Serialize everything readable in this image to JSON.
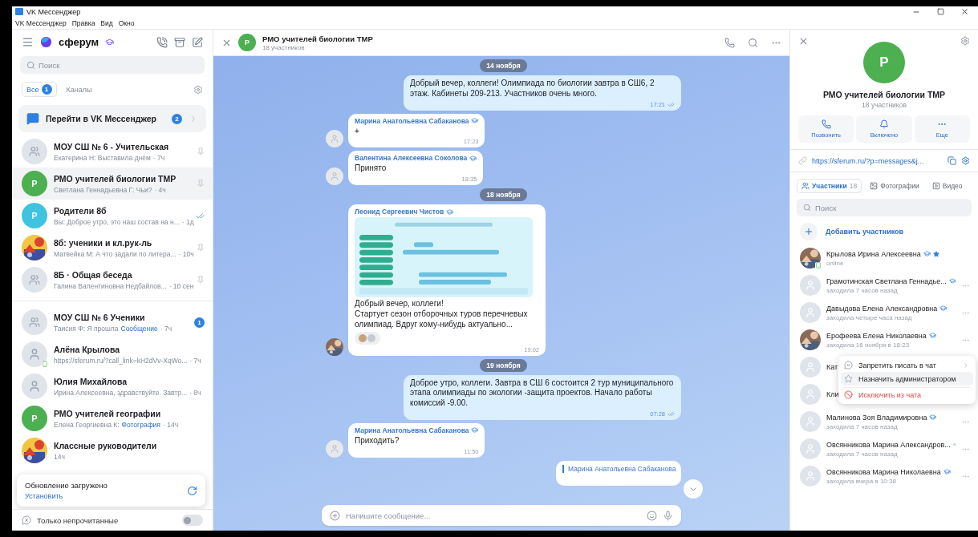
{
  "window": {
    "title": "VK Мессенджер"
  },
  "menu_bar": [
    "VK Мессенджер",
    "Правка",
    "Вид",
    "Окно"
  ],
  "sidebar": {
    "logo": "сферум",
    "search": {
      "placeholder": "Поиск"
    },
    "filters": [
      {
        "label": "Все",
        "badge": "1",
        "selected": true
      },
      {
        "label": "Каналы",
        "selected": false
      }
    ],
    "promo": {
      "label": "Перейти в VK Мессенджер",
      "badge": "2"
    },
    "pinned_chats": [
      {
        "name": "МОУ СШ № 6 - Учительская",
        "preview": "Екатерина Н: Выставила днём",
        "time": "· 7ч",
        "avatar": {
          "kind": "group"
        },
        "pinned": true,
        "selected": false
      },
      {
        "name": "РМО учителей биологии ТМР",
        "preview": "Светлана Геннадьевна Г: Чьи?",
        "time": "· 4ч",
        "avatar": {
          "kind": "letter",
          "letter": "Р",
          "color": "#4caf50"
        },
        "pinned": true,
        "selected": true
      },
      {
        "name": "Родители 8б",
        "preview": "Вы: Доброе утро, это наш состав на н...",
        "time": "· 1д",
        "avatar": {
          "kind": "letter",
          "letter": "Р",
          "color": "#3ec3e0"
        },
        "pinned": false,
        "read": true,
        "selected": false
      },
      {
        "name": "8б: ученики и кл.рук-ль",
        "preview": "Матвейка М: А что задали по литера...",
        "time": "· 10ч",
        "pinned": true,
        "selected": false
      },
      {
        "name": "8Б · Общая беседа",
        "preview": "Галина Валентиновна Недбайлов...",
        "time": "· 10 сен",
        "avatar": {
          "kind": "group"
        },
        "pinned": true,
        "selected": false
      }
    ],
    "chats": [
      {
        "name": "МОУ СШ № 6 Ученики",
        "preview": "Таисия Ф: Я прошла",
        "attachment": "Сообщение",
        "time": "· 7ч",
        "avatar": {
          "kind": "group"
        },
        "unread": "1",
        "selected": false
      },
      {
        "name": "Алёна Крылова",
        "preview": "https://sferum.ru/?call_link=kH2dVv-XqWo...",
        "time": "· 7ч",
        "avatar": {
          "kind": "person"
        },
        "online": true,
        "selected": false
      },
      {
        "name": "Юлия Михайлова",
        "preview": "Ирина Алексеевна, здравствуйте. Завтр...",
        "time": "· 8ч",
        "avatar": {
          "kind": "person"
        },
        "selected": false
      },
      {
        "name": "РМО учителей географии",
        "preview": "Елена Георгиевна К:",
        "attachment": "Фотография",
        "time": "· 14ч",
        "avatar": {
          "kind": "letter",
          "letter": "Р",
          "color": "#4caf50"
        },
        "selected": false
      },
      {
        "name": "Классные руководители",
        "time": "14ч",
        "selected": false
      }
    ],
    "toast": {
      "title": "Обновление загружено",
      "action": "Установить"
    },
    "unread_only": {
      "label": "Только непрочитанные",
      "on": false
    }
  },
  "chat": {
    "avatar_letter": "Р",
    "title": "РМО учителей биологии ТМР",
    "subtitle": "18 участников",
    "messages": [
      {
        "kind": "date",
        "text": "14 ноября"
      },
      {
        "kind": "outgoing",
        "text": "Добрый вечер, коллеги! Олимпиада по биологии завтра в СШ6, 2 этаж. Кабинеты 209-213. Участников очень много.",
        "time": "17:21",
        "read": true
      },
      {
        "kind": "incoming",
        "author": "Марина Анатольевна Сабаканова",
        "text": "+",
        "time": "17:23"
      },
      {
        "kind": "incoming",
        "author": "Валентина Алексеевна Соколова",
        "text": "Принято",
        "time": "18:35"
      },
      {
        "kind": "date",
        "text": "18 ноября"
      },
      {
        "kind": "incoming",
        "author": "Леонид Сергеевич Чистов",
        "picture": true,
        "text": "Добрый вечер, коллеги!\nСтартует сезон отборочных туров перечневых олимпиад. Вдруг кому-нибудь актуально...",
        "reactions": true,
        "time": "19:02",
        "photo_avatar": true
      },
      {
        "kind": "date",
        "text": "19 ноября"
      },
      {
        "kind": "outgoing",
        "text": "Доброе утро, коллеги. Завтра в СШ 6 состоится 2 тур муниципального этапа олимпиады по экологии -защита проектов. Начало работы комиссий -9.00.",
        "time": "07:28",
        "read": true
      },
      {
        "kind": "incoming",
        "author": "Марина Анатольевна Сабаканова",
        "text": "Приходить?",
        "time": "11:50"
      },
      {
        "kind": "reply",
        "author": "Марина Анатольевна Сабаканова"
      }
    ],
    "composer": {
      "placeholder": "Напишите сообщение..."
    }
  },
  "info_panel": {
    "title": "РМО учителей биологии ТМР",
    "subtitle": "18 участников",
    "avatar_letter": "Р",
    "actions": [
      {
        "kind": "call",
        "label": "Позвонить"
      },
      {
        "kind": "bell",
        "label": "Включено"
      },
      {
        "kind": "more",
        "label": "Еще"
      }
    ],
    "link": "https://sferum.ru/?p=messages&j...",
    "tabs": [
      {
        "kind": "members",
        "label": "Участники",
        "count": "18",
        "selected": true
      },
      {
        "kind": "photos",
        "label": "Фотографии",
        "selected": false
      },
      {
        "kind": "video",
        "label": "Видео",
        "selected": false
      }
    ],
    "search": {
      "placeholder": "Поиск"
    },
    "add_members": "Добавить участников",
    "members": [
      {
        "name": "Крылова Ирина Алексеевна",
        "status": "online",
        "kind": "picture",
        "verified": true,
        "admin": true,
        "online": true,
        "has_more": false
      },
      {
        "name": "Грамотинская Светлана Геннадье...",
        "status": "заходила 7 часов назад",
        "kind": "placeholder",
        "verified": true,
        "has_more": true
      },
      {
        "name": "Давыдова Елена Александровна",
        "status": "заходила четыре часа назад",
        "kind": "placeholder",
        "verified": true,
        "has_more": true
      },
      {
        "name": "Ерофеева Елена Николаевна",
        "status": "заходила 16 ноября в 18:23",
        "kind": "picture",
        "verified": true,
        "has_more": true
      },
      {
        "name": "Кат",
        "kind": "placeholder",
        "verified": false,
        "has_more": false
      },
      {
        "name": "Кли",
        "kind": "placeholder",
        "verified": false,
        "has_more": false
      },
      {
        "name": "Малинова Зоя Владимировна",
        "status": "заходила 7 часов назад",
        "kind": "placeholder",
        "verified": true,
        "has_more": true
      },
      {
        "name": "Овсянникова Марина Александров...",
        "status": "заходила 7 часов назад",
        "kind": "placeholder",
        "verified": true,
        "has_more": true
      },
      {
        "name": "Овсянникова Марина Николаевна",
        "status": "заходила вчера в 10:38",
        "kind": "placeholder",
        "verified": true,
        "has_more": true
      }
    ],
    "context_menu": [
      {
        "kind": "submenu",
        "label": "Запретить писать в чат",
        "selected": false
      },
      {
        "kind": "normal",
        "label": "Назначить администратором",
        "selected": true
      },
      {
        "kind": "danger",
        "label": "Исключить из чата",
        "selected": false
      }
    ]
  }
}
